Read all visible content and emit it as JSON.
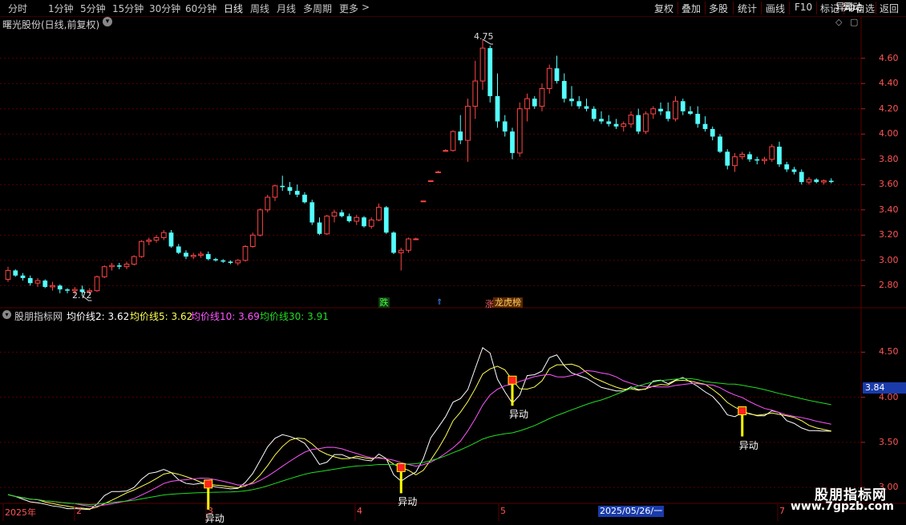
{
  "toolbar": {
    "periods": [
      "分时",
      "1分钟",
      "5分钟",
      "15分钟",
      "30分钟",
      "60分钟",
      "日线",
      "周线",
      "月线",
      "多周期",
      "更多"
    ],
    "more_arrow": ">",
    "buttons": [
      "复权",
      "叠加",
      "多股",
      "统计",
      "画线",
      "F10",
      "+自选",
      "返回"
    ],
    "active_period": "日线"
  },
  "title": {
    "stock": "曙光股份(日线,前复权)",
    "expand_icon": "chevron-down-icon"
  },
  "price_axis": {
    "ticks": [
      "4.60",
      "4.40",
      "4.20",
      "4.00",
      "3.80",
      "3.60",
      "3.40",
      "3.20",
      "3.00",
      "2.80"
    ]
  },
  "annotations": {
    "high_label": "4.75",
    "low_label": "2.72",
    "signal_die": "跌",
    "signal_longhu": "龙虎榜",
    "signal_zhang": "涨"
  },
  "indicator": {
    "name": "股朋指标网",
    "ma2_label": "均价线2: 3.62",
    "ma5_label": "均价线5: 3.62",
    "ma10_label": "均价线10: 3.69",
    "ma30_label": "均价线30: 3.91",
    "axis_ticks": [
      "4.50",
      "4.00",
      "3.50",
      "3.00"
    ],
    "current_value": "3.84",
    "signal_text": "异动"
  },
  "date_axis": {
    "labels": [
      "2025年",
      "2",
      "3",
      "4",
      "5",
      "7"
    ],
    "cursor_date": "2025/05/26/一"
  },
  "watermark": {
    "line1": "股朋指标网",
    "line2": "www.7gpzb.com"
  },
  "colors": {
    "up": "#ff4444",
    "down": "#54ffff",
    "ma2": "#ffffff",
    "ma5": "#ffff55",
    "ma10": "#ff55ff",
    "ma30": "#22dd22",
    "grid": "#5a0000",
    "signal_bar": "#ffff00",
    "signal_box": "#ff2020"
  },
  "chart_data": {
    "type": "candlestick",
    "candles": [
      [
        2.85,
        2.95,
        2.83,
        2.92
      ],
      [
        2.92,
        2.93,
        2.87,
        2.88
      ],
      [
        2.88,
        2.9,
        2.84,
        2.86
      ],
      [
        2.86,
        2.88,
        2.8,
        2.82
      ],
      [
        2.82,
        2.86,
        2.79,
        2.84
      ],
      [
        2.84,
        2.85,
        2.78,
        2.79
      ],
      [
        2.79,
        2.83,
        2.76,
        2.8
      ],
      [
        2.8,
        2.81,
        2.74,
        2.77
      ],
      [
        2.77,
        2.78,
        2.74,
        2.76
      ],
      [
        2.76,
        2.79,
        2.73,
        2.77
      ],
      [
        2.77,
        2.8,
        2.72,
        2.75
      ],
      [
        2.75,
        2.78,
        2.73,
        2.76
      ],
      [
        2.76,
        2.88,
        2.75,
        2.87
      ],
      [
        2.87,
        2.96,
        2.86,
        2.95
      ],
      [
        2.95,
        2.98,
        2.92,
        2.96
      ],
      [
        2.96,
        2.98,
        2.93,
        2.95
      ],
      [
        2.95,
        2.99,
        2.93,
        2.97
      ],
      [
        2.97,
        3.04,
        2.96,
        3.03
      ],
      [
        3.03,
        3.16,
        3.02,
        3.15
      ],
      [
        3.15,
        3.18,
        3.12,
        3.16
      ],
      [
        3.16,
        3.2,
        3.14,
        3.18
      ],
      [
        3.18,
        3.24,
        3.16,
        3.22
      ],
      [
        3.22,
        3.24,
        3.1,
        3.11
      ],
      [
        3.11,
        3.13,
        3.05,
        3.06
      ],
      [
        3.06,
        3.08,
        3.01,
        3.03
      ],
      [
        3.03,
        3.06,
        3.01,
        3.04
      ],
      [
        3.04,
        3.07,
        3.02,
        3.05
      ],
      [
        3.05,
        3.07,
        3.0,
        3.01
      ],
      [
        3.01,
        3.02,
        2.99,
        3.0
      ],
      [
        3.0,
        3.01,
        2.98,
        2.99
      ],
      [
        2.99,
        3.0,
        2.97,
        2.98
      ],
      [
        2.98,
        3.01,
        2.96,
        3.0
      ],
      [
        3.0,
        3.12,
        2.99,
        3.11
      ],
      [
        3.11,
        3.22,
        3.1,
        3.2
      ],
      [
        3.2,
        3.41,
        3.19,
        3.4
      ],
      [
        3.4,
        3.52,
        3.38,
        3.5
      ],
      [
        3.5,
        3.6,
        3.47,
        3.59
      ],
      [
        3.59,
        3.67,
        3.55,
        3.58
      ],
      [
        3.58,
        3.62,
        3.52,
        3.55
      ],
      [
        3.55,
        3.6,
        3.5,
        3.52
      ],
      [
        3.52,
        3.54,
        3.45,
        3.46
      ],
      [
        3.46,
        3.48,
        3.28,
        3.3
      ],
      [
        3.3,
        3.34,
        3.2,
        3.21
      ],
      [
        3.21,
        3.36,
        3.2,
        3.35
      ],
      [
        3.35,
        3.4,
        3.3,
        3.38
      ],
      [
        3.38,
        3.4,
        3.34,
        3.35
      ],
      [
        3.35,
        3.37,
        3.3,
        3.31
      ],
      [
        3.31,
        3.36,
        3.28,
        3.34
      ],
      [
        3.34,
        3.35,
        3.26,
        3.27
      ],
      [
        3.27,
        3.34,
        3.25,
        3.32
      ],
      [
        3.32,
        3.45,
        3.31,
        3.42
      ],
      [
        3.42,
        3.43,
        3.21,
        3.22
      ],
      [
        3.22,
        3.23,
        3.05,
        3.06
      ],
      [
        3.06,
        3.1,
        2.92,
        3.08
      ],
      [
        3.08,
        3.18,
        3.06,
        3.17
      ],
      [
        3.17,
        3.18,
        3.17,
        3.17
      ],
      [
        3.47,
        3.47,
        3.47,
        3.47
      ],
      [
        3.63,
        3.63,
        3.63,
        3.63
      ],
      [
        3.7,
        3.71,
        3.7,
        3.7
      ],
      [
        3.87,
        3.88,
        3.87,
        3.87
      ],
      [
        3.87,
        4.03,
        3.86,
        4.02
      ],
      [
        4.02,
        4.15,
        3.92,
        3.95
      ],
      [
        3.95,
        4.28,
        3.78,
        4.22
      ],
      [
        4.22,
        4.58,
        4.12,
        4.42
      ],
      [
        4.42,
        4.75,
        4.35,
        4.68
      ],
      [
        4.68,
        4.7,
        4.25,
        4.3
      ],
      [
        4.3,
        4.48,
        4.05,
        4.1
      ],
      [
        4.1,
        4.15,
        3.98,
        4.02
      ],
      [
        4.02,
        4.05,
        3.8,
        3.85
      ],
      [
        3.85,
        4.25,
        3.82,
        4.2
      ],
      [
        4.2,
        4.32,
        4.1,
        4.28
      ],
      [
        4.28,
        4.3,
        4.2,
        4.22
      ],
      [
        4.22,
        4.4,
        4.18,
        4.36
      ],
      [
        4.36,
        4.55,
        4.32,
        4.52
      ],
      [
        4.52,
        4.62,
        4.4,
        4.42
      ],
      [
        4.42,
        4.48,
        4.25,
        4.28
      ],
      [
        4.28,
        4.38,
        4.22,
        4.26
      ],
      [
        4.26,
        4.3,
        4.2,
        4.22
      ],
      [
        4.22,
        4.28,
        4.18,
        4.2
      ],
      [
        4.2,
        4.22,
        4.1,
        4.12
      ],
      [
        4.12,
        4.18,
        4.08,
        4.1
      ],
      [
        4.1,
        4.15,
        4.06,
        4.08
      ],
      [
        4.08,
        4.12,
        4.04,
        4.06
      ],
      [
        4.06,
        4.1,
        4.02,
        4.08
      ],
      [
        4.08,
        4.18,
        4.05,
        4.15
      ],
      [
        4.15,
        4.2,
        4.0,
        4.02
      ],
      [
        4.02,
        4.18,
        4.0,
        4.16
      ],
      [
        4.16,
        4.22,
        4.12,
        4.2
      ],
      [
        4.2,
        4.25,
        4.15,
        4.18
      ],
      [
        4.18,
        4.25,
        4.1,
        4.12
      ],
      [
        4.12,
        4.3,
        4.1,
        4.26
      ],
      [
        4.26,
        4.28,
        4.15,
        4.18
      ],
      [
        4.18,
        4.22,
        4.15,
        4.16
      ],
      [
        4.16,
        4.22,
        4.05,
        4.08
      ],
      [
        4.08,
        4.14,
        4.02,
        4.04
      ],
      [
        4.04,
        4.06,
        3.95,
        3.98
      ],
      [
        3.98,
        4.0,
        3.85,
        3.86
      ],
      [
        3.86,
        3.88,
        3.72,
        3.75
      ],
      [
        3.75,
        3.85,
        3.7,
        3.82
      ],
      [
        3.82,
        3.86,
        3.8,
        3.84
      ],
      [
        3.84,
        3.86,
        3.78,
        3.8
      ],
      [
        3.8,
        3.82,
        3.76,
        3.79
      ],
      [
        3.79,
        3.82,
        3.76,
        3.8
      ],
      [
        3.8,
        3.92,
        3.78,
        3.9
      ],
      [
        3.9,
        3.94,
        3.74,
        3.76
      ],
      [
        3.76,
        3.78,
        3.7,
        3.72
      ],
      [
        3.72,
        3.74,
        3.68,
        3.7
      ],
      [
        3.7,
        3.72,
        3.6,
        3.62
      ],
      [
        3.62,
        3.66,
        3.6,
        3.64
      ],
      [
        3.64,
        3.65,
        3.61,
        3.62
      ],
      [
        3.62,
        3.64,
        3.6,
        3.63
      ],
      [
        3.63,
        3.65,
        3.61,
        3.62
      ]
    ],
    "price_range": [
      2.65,
      4.82
    ],
    "indicator_range": [
      2.85,
      4.85
    ],
    "signals_at": [
      27,
      53,
      68,
      99,
      112,
      113
    ]
  }
}
